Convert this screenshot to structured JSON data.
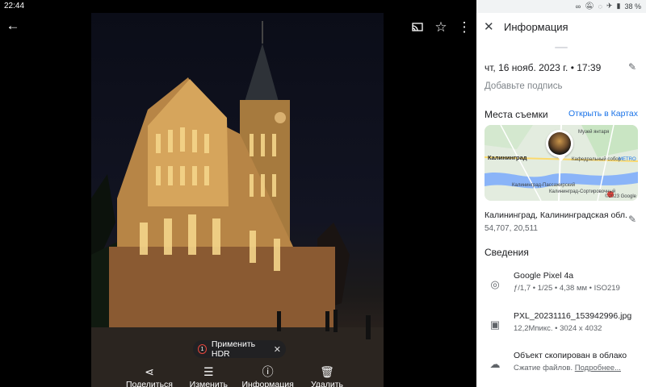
{
  "status": {
    "time": "22:44",
    "battery": "38 %"
  },
  "viewer": {
    "hdr_chip": "Применить HDR",
    "actions": [
      {
        "label": "Поделиться",
        "icon": "share-icon"
      },
      {
        "label": "Изменить",
        "icon": "tune-icon"
      },
      {
        "label": "Информация",
        "icon": "info-icon"
      },
      {
        "label": "Удалить",
        "icon": "delete-icon"
      }
    ]
  },
  "panel": {
    "title": "Информация",
    "date": "чт, 16 нояб. 2023 г. • 17:39",
    "caption_placeholder": "Добавьте подпись",
    "places_header": "Места съемки",
    "open_maps": "Открыть в Картах",
    "map": {
      "city": "Калининград",
      "labels": [
        "Калининград-Пассажирский",
        "Музей янтаря",
        "Кафедральный собор",
        "METRO",
        "Калининград-Сортировочный"
      ],
      "copyright": "©2023 Google"
    },
    "place_name": "Калининград, Калининградская обл.",
    "coordinates": "54,707, 20,511",
    "details_header": "Сведения",
    "camera": {
      "model": "Google Pixel 4a",
      "specs": "ƒ/1,7  •  1/25  •  4,38 мм  •  ISO219"
    },
    "file": {
      "name": "PXL_20231116_153942996.jpg",
      "specs": "12,2Мпикс.  •  3024 x 4032"
    },
    "cloud": {
      "title": "Объект скопирован в облако",
      "subtitle": "Сжатие файлов.",
      "more": "Подробнее..."
    }
  }
}
